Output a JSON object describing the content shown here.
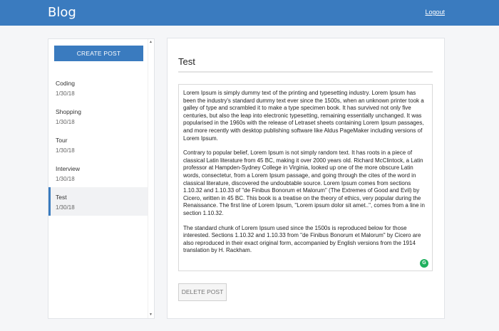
{
  "header": {
    "brand": "Blog",
    "logout_label": "Logout"
  },
  "sidebar": {
    "create_label": "CREATE POST",
    "posts": [
      {
        "title": "Coding",
        "date": "1/30/18"
      },
      {
        "title": "Shopping",
        "date": "1/30/18"
      },
      {
        "title": "Tour",
        "date": "1/30/18"
      },
      {
        "title": "Interview",
        "date": "1/30/18"
      },
      {
        "title": "Test",
        "date": "1/30/18"
      }
    ]
  },
  "main": {
    "title": "Test",
    "body": [
      "Lorem Ipsum is simply dummy text of the printing and typesetting industry. Lorem Ipsum has been the industry's standard dummy text ever since the 1500s, when an unknown printer took a galley of type and scrambled it to make a type specimen book. It has survived not only five centuries, but also the leap into electronic typesetting, remaining essentially unchanged. It was popularised in the 1960s with the release of Letraset sheets containing Lorem Ipsum passages, and more recently with desktop publishing software like Aldus PageMaker including versions of Lorem Ipsum.",
      "Contrary to popular belief, Lorem Ipsum is not simply random text. It has roots in a piece of classical Latin literature from 45 BC, making it over 2000 years old. Richard McClintock, a Latin professor at Hampden-Sydney College in Virginia, looked up one of the more obscure Latin words, consectetur, from a Lorem Ipsum passage, and going through the cites of the word in classical literature, discovered the undoubtable source. Lorem Ipsum comes from sections 1.10.32 and 1.10.33 of \"de Finibus Bonorum et Malorum\" (The Extremes of Good and Evil) by Cicero, written in 45 BC. This book is a treatise on the theory of ethics, very popular during the Renaissance. The first line of Lorem Ipsum, \"Lorem ipsum dolor sit amet..\", comes from a line in section 1.10.32.",
      "The standard chunk of Lorem Ipsum used since the 1500s is reproduced below for those interested. Sections 1.10.32 and 1.10.33 from \"de Finibus Bonorum et Malorum\" by Cicero are also reproduced in their exact original form, accompanied by English versions from the 1914 translation by H. Rackham."
    ],
    "grammarly_badge": "G",
    "delete_label": "DELETE POST"
  },
  "colors": {
    "primary": "#3a7bbf",
    "grammarly": "#1fb05e"
  }
}
